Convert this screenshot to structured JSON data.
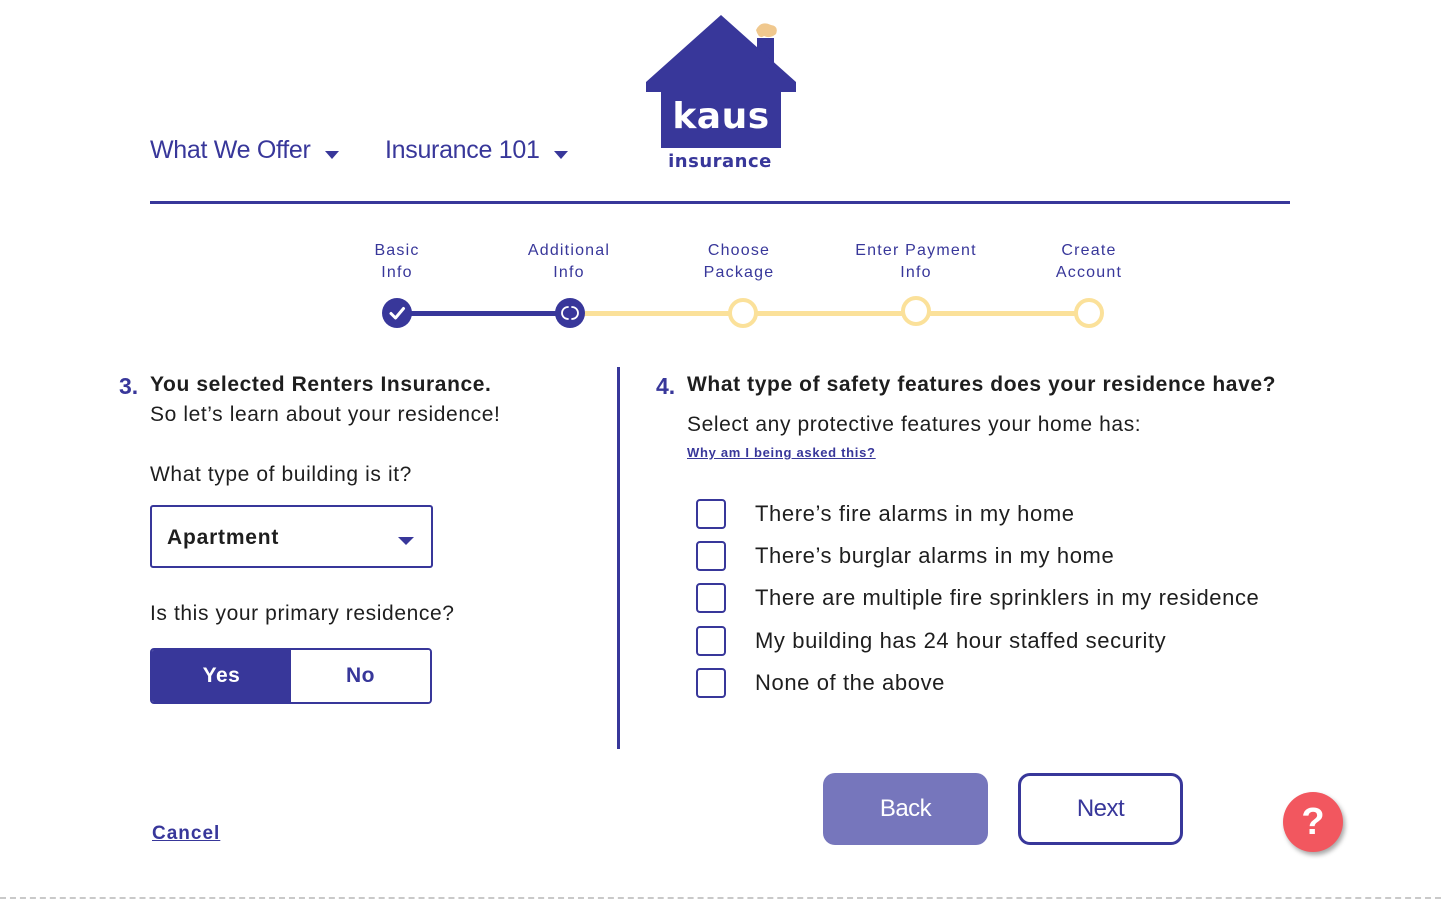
{
  "nav": {
    "what_we_offer": "What We Offer",
    "insurance_101": "Insurance 101"
  },
  "logo": {
    "word": "kaus",
    "sub": "insurance"
  },
  "steps": [
    {
      "line1": "Basic",
      "line2": "Info",
      "state": "done"
    },
    {
      "line1": "Additional",
      "line2": "Info",
      "state": "current"
    },
    {
      "line1": "Choose",
      "line2": "Package",
      "state": "todo"
    },
    {
      "line1": "Enter Payment",
      "line2": "Info",
      "state": "todo"
    },
    {
      "line1": "Create",
      "line2": "Account",
      "state": "todo"
    }
  ],
  "q3": {
    "number": "3.",
    "title": "You selected Renters Insurance.",
    "subtitle": "So let’s learn about your residence!",
    "building_label": "What type of building is it?",
    "building_value": "Apartment",
    "primary_label": "Is this your primary residence?",
    "yes": "Yes",
    "no": "No",
    "selected": "Yes"
  },
  "q4": {
    "number": "4.",
    "title": "What type of safety features does your residence have?",
    "instruction": "Select any protective features your home has:",
    "why_link": "Why am I being asked this?",
    "options": [
      "There’s fire alarms in my home",
      "There’s burglar alarms in my home",
      "There are multiple fire sprinklers in my residence",
      "My building has 24 hour staffed security",
      "None of the above"
    ]
  },
  "actions": {
    "cancel": "Cancel",
    "back": "Back",
    "next": "Next",
    "help": "?"
  },
  "colors": {
    "primary": "#38379a",
    "secondary_button": "#7676bc",
    "progress_pending": "#fbe19a",
    "help": "#f2575f"
  },
  "icons": {
    "house_logo": "house-icon",
    "done_step": "checkmark-icon",
    "current_step": "spinner-icon",
    "dropdown": "caret-down-icon",
    "help": "question-icon"
  }
}
